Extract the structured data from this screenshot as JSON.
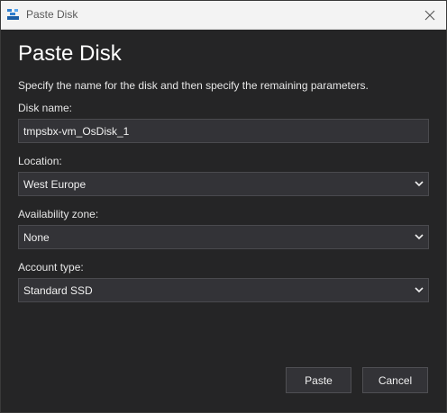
{
  "window": {
    "title": "Paste Disk"
  },
  "dialog": {
    "heading": "Paste Disk",
    "description": "Specify the name for the disk and then specify the remaining parameters.",
    "disk_name": {
      "label": "Disk name:",
      "value": "tmpsbx-vm_OsDisk_1"
    },
    "location": {
      "label": "Location:",
      "value": "West Europe"
    },
    "availability_zone": {
      "label": "Availability zone:",
      "value": "None"
    },
    "account_type": {
      "label": "Account type:",
      "value": "Standard SSD"
    },
    "buttons": {
      "paste": "Paste",
      "cancel": "Cancel"
    }
  },
  "icons": {
    "app": "storage-explorer-icon",
    "close": "close-icon",
    "dropdown": "chevron-down-icon"
  },
  "colors": {
    "background": "#252526",
    "input_background": "#333337",
    "titlebar": "#f3f3f3",
    "text": "#ffffff"
  }
}
